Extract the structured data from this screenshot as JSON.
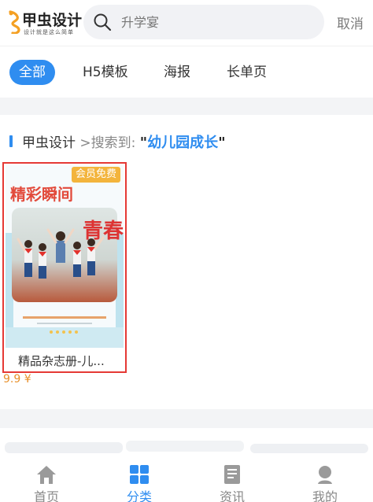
{
  "header": {
    "logo_text": "甲虫设计",
    "logo_slogan": "设计就是这么简单",
    "search_placeholder": "升学宴",
    "cancel_label": "取消"
  },
  "tabs": [
    {
      "label": "全部",
      "active": true
    },
    {
      "label": "H5模板",
      "active": false
    },
    {
      "label": "海报",
      "active": false
    },
    {
      "label": "长单页",
      "active": false
    }
  ],
  "results": {
    "site": "甲虫设计",
    "separator": ">搜索到:",
    "quote_open": "\"",
    "keyword": "幼儿园成长",
    "quote_close": "\""
  },
  "cards": [
    {
      "badge": "会员免费",
      "thumb_title": "精彩瞬间",
      "thumb_side_text": "青春的",
      "title": "精品杂志册-儿...",
      "price": "9.9 ¥"
    }
  ],
  "nav": [
    {
      "label": "首页",
      "icon": "home-icon",
      "active": false
    },
    {
      "label": "分类",
      "icon": "grid-icon",
      "active": true
    },
    {
      "label": "资讯",
      "icon": "news-icon",
      "active": false
    },
    {
      "label": "我的",
      "icon": "user-icon",
      "active": false
    }
  ],
  "colors": {
    "accent": "#2f8df0",
    "badge": "#f3b43c",
    "price": "#e8902a",
    "highlight_border": "#e53935"
  }
}
